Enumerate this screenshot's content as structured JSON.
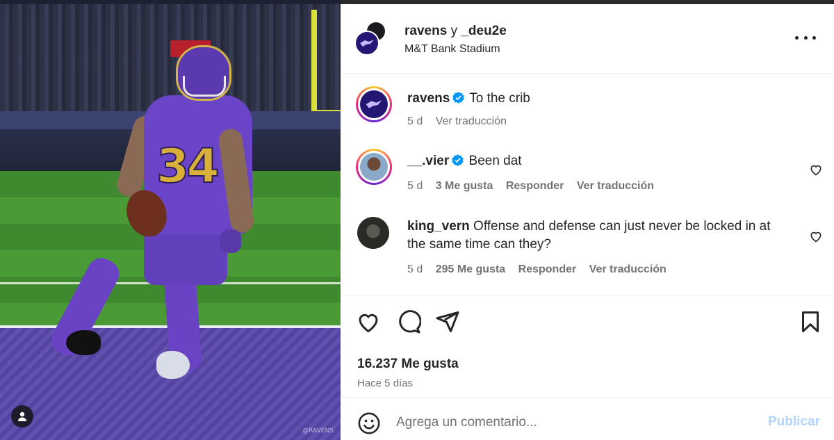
{
  "post": {
    "header": {
      "author": "ravens",
      "connector": "y",
      "coauthor": "_deu2e",
      "location": "M&T Bank Stadium"
    },
    "media": {
      "jersey_number": "34",
      "watermark": "@RAVENS"
    },
    "comments": [
      {
        "username": "ravens",
        "verified": true,
        "text": "To the crib",
        "age": "5 d",
        "likes": "",
        "reply_label": "",
        "translate_label": "Ver traducción"
      },
      {
        "username": "__.vier",
        "verified": true,
        "text": "Been dat",
        "age": "5 d",
        "likes": "3 Me gusta",
        "reply_label": "Responder",
        "translate_label": "Ver traducción"
      },
      {
        "username": "king_vern",
        "verified": false,
        "text": "Offense and defense can just never be locked in at the same time can they?",
        "age": "5 d",
        "likes": "295 Me gusta",
        "reply_label": "Responder",
        "translate_label": "Ver traducción"
      }
    ],
    "like_count": "16.237 Me gusta",
    "posted_ago": "Hace 5 días",
    "composer": {
      "placeholder": "Agrega un comentario...",
      "publish_label": "Publicar"
    }
  },
  "colors": {
    "brand_purple": "#241773",
    "verified_blue": "#0095f6",
    "publish_disabled": "#b3d4fc",
    "secondary_text": "#737373"
  },
  "icons": [
    "more-icon",
    "verified-icon",
    "heart-icon",
    "comment-icon",
    "share-icon",
    "bookmark-icon",
    "emoji-icon",
    "user-tag-icon",
    "ravens-logo-icon"
  ]
}
